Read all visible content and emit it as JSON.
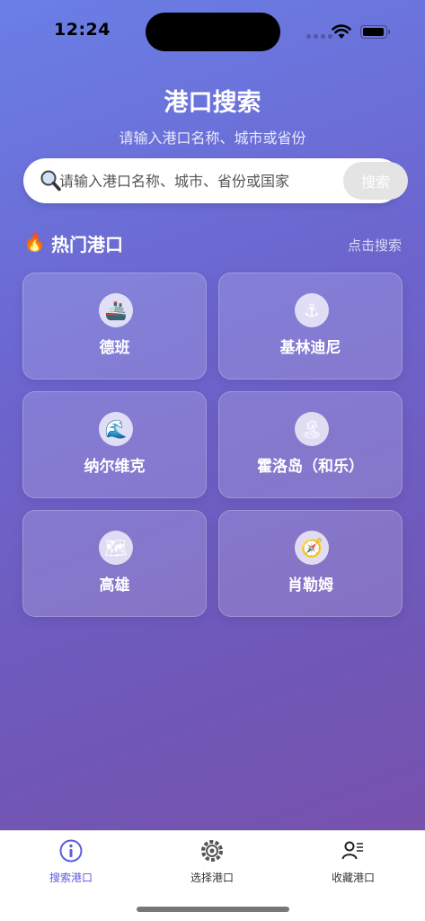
{
  "status_bar": {
    "time": "12:24"
  },
  "header": {
    "title": "港口搜索",
    "subtitle": "请输入港口名称、城市或省份"
  },
  "search": {
    "placeholder": "请输入港口名称、城市、省份或国家",
    "value": "",
    "button_label": "搜索"
  },
  "popular": {
    "icon": "fire-icon",
    "title": "热门港口",
    "action_label": "点击搜索",
    "ports": [
      {
        "name": "德班",
        "icon": "ship-icon",
        "glyph": "🚢"
      },
      {
        "name": "基林迪尼",
        "icon": "anchor-icon",
        "glyph": "⚓"
      },
      {
        "name": "纳尔维克",
        "icon": "wave-icon",
        "glyph": "🌊"
      },
      {
        "name": "霍洛岛（和乐）",
        "icon": "island-icon",
        "glyph": "🏝"
      },
      {
        "name": "高雄",
        "icon": "map-icon",
        "glyph": "🗺"
      },
      {
        "name": "肖勒姆",
        "icon": "compass-icon",
        "glyph": "🧭"
      }
    ]
  },
  "tab_bar": {
    "tabs": [
      {
        "label": "搜索港口",
        "icon": "info-icon",
        "active": true
      },
      {
        "label": "选择港口",
        "icon": "settings-icon",
        "active": false
      },
      {
        "label": "收藏港口",
        "icon": "user-list-icon",
        "active": false
      }
    ]
  },
  "colors": {
    "gradient_start": "#6a7fe6",
    "gradient_end": "#7a4fa8",
    "active_tab": "#5b5ce0",
    "search_button": "#e4e4e4"
  }
}
